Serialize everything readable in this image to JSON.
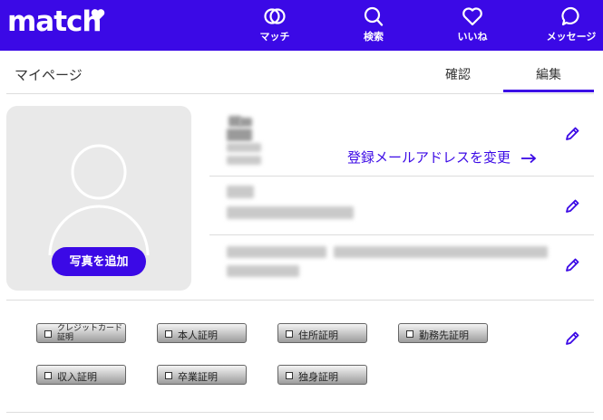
{
  "header": {
    "logo": "match",
    "nav": [
      {
        "label": "マッチ",
        "icon": "match-rings-icon"
      },
      {
        "label": "検索",
        "icon": "search-icon"
      },
      {
        "label": "いいね",
        "icon": "heart-icon"
      },
      {
        "label": "メッセージ",
        "icon": "chat-bubble-icon"
      }
    ]
  },
  "page": {
    "title": "マイページ",
    "tabs": [
      {
        "label": "確認",
        "active": false
      },
      {
        "label": "編集",
        "active": true
      }
    ]
  },
  "profile": {
    "add_photo_label": "写真を追加",
    "change_email_label": "登録メールアドレスを変更"
  },
  "verifications": [
    {
      "label": "クレジットカード証明"
    },
    {
      "label": "本人証明"
    },
    {
      "label": "住所証明"
    },
    {
      "label": "勤務先証明"
    },
    {
      "label": "収入証明"
    },
    {
      "label": "卒業証明"
    },
    {
      "label": "独身証明"
    }
  ],
  "colors": {
    "brand": "#3b09e6"
  }
}
